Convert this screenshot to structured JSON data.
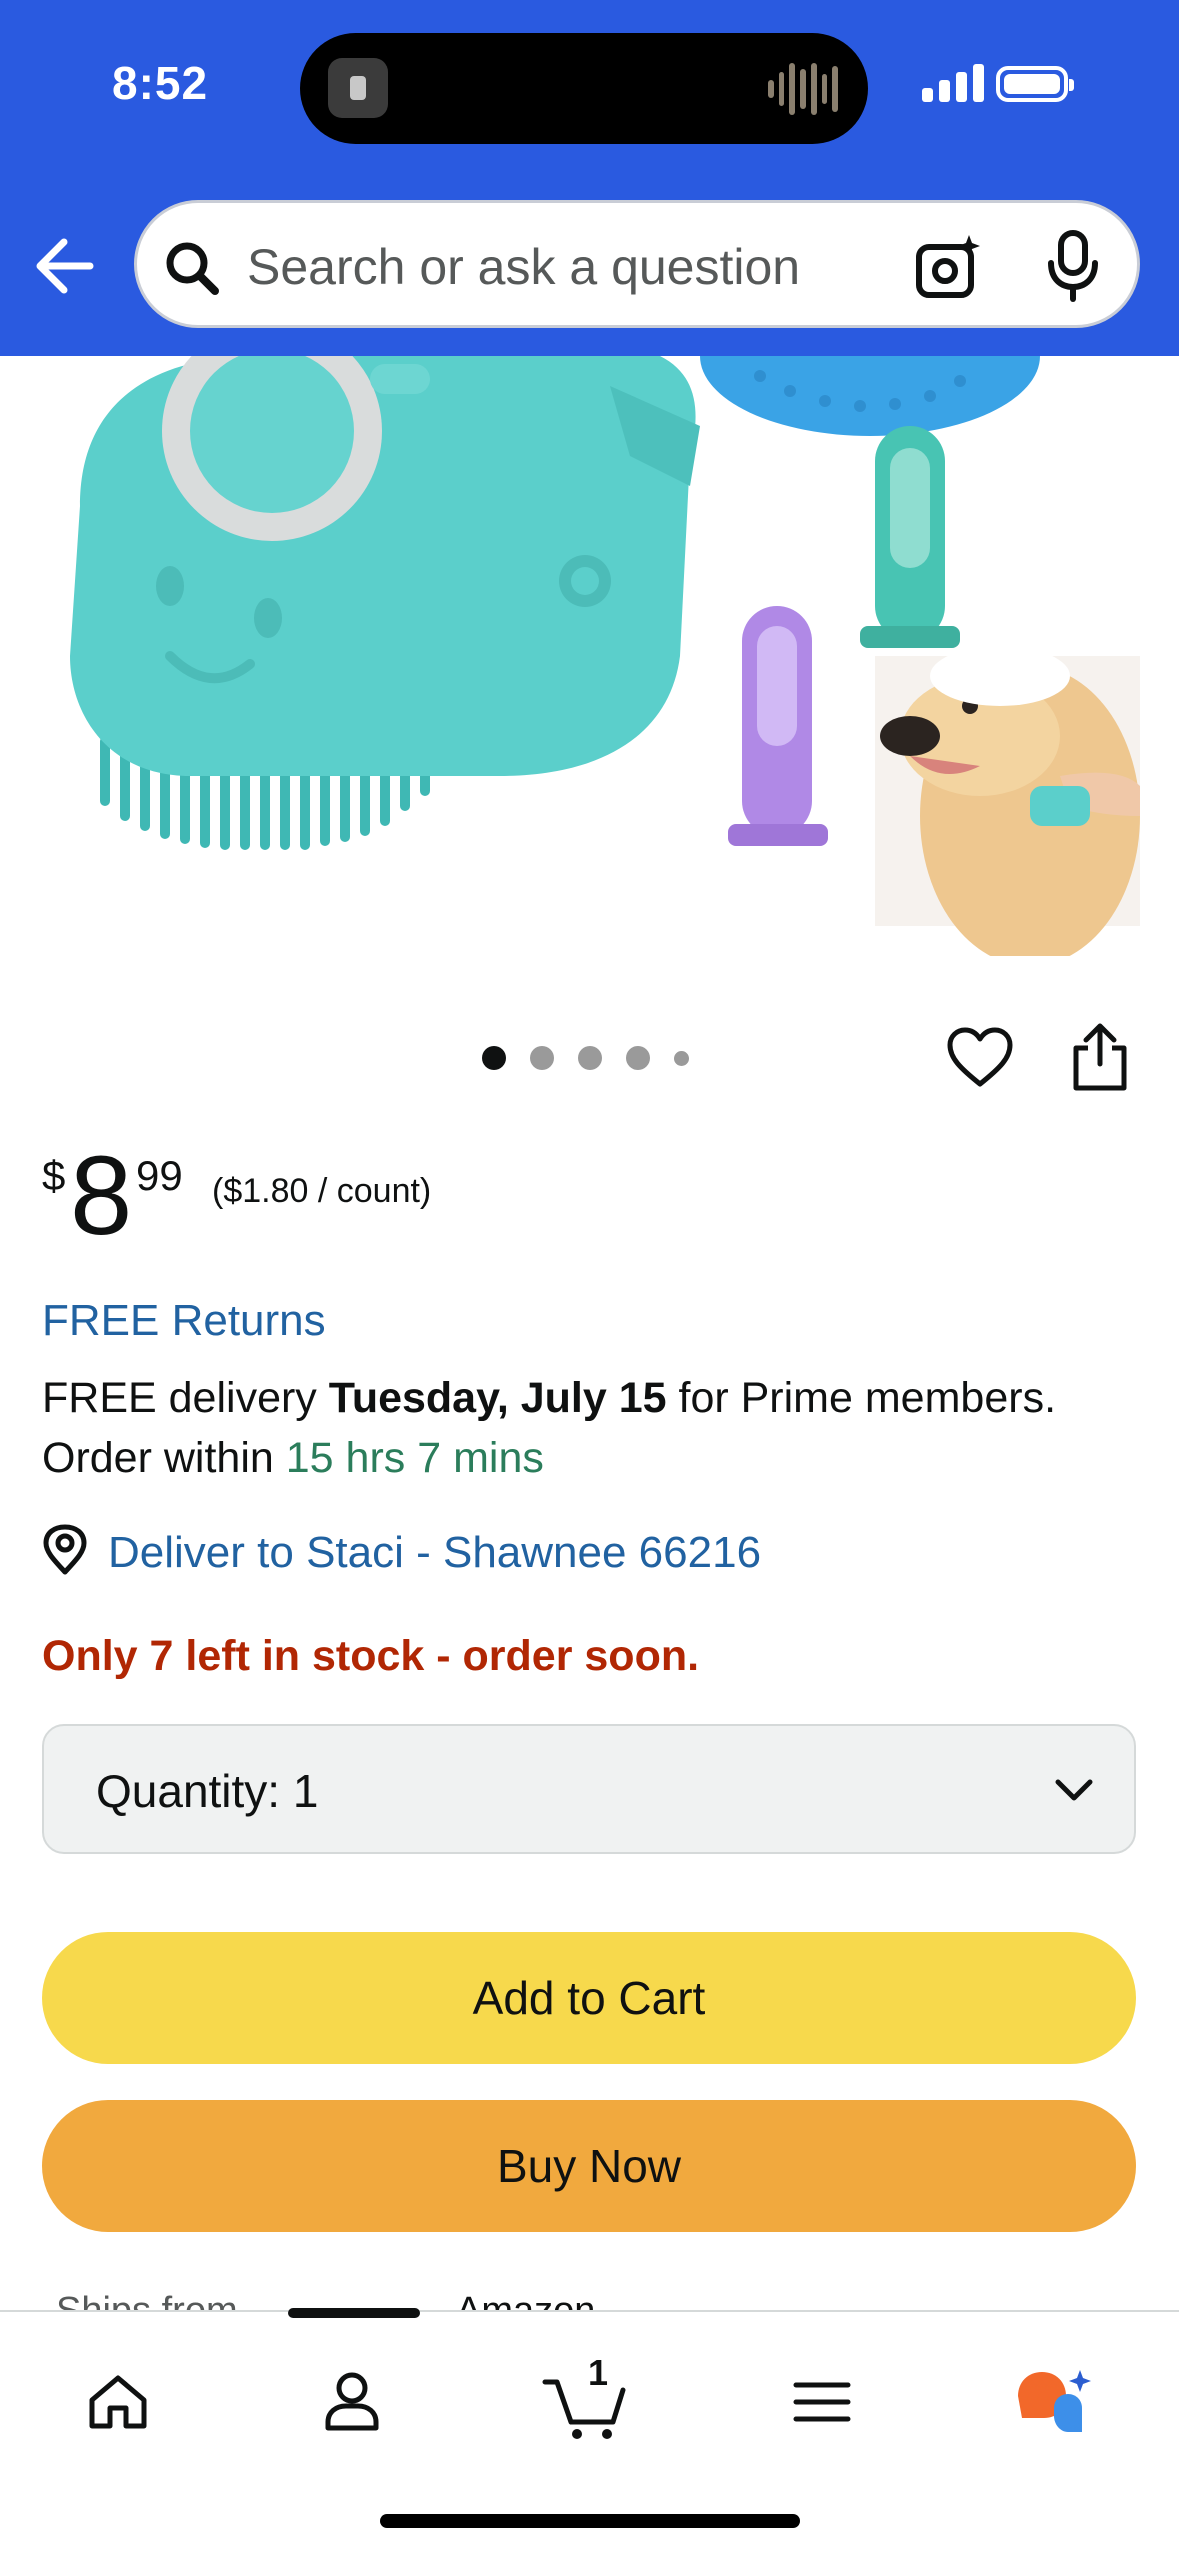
{
  "status_bar": {
    "time": "8:52"
  },
  "header": {
    "search": {
      "placeholder": "Search or ask a question",
      "value": ""
    },
    "icons": [
      "back-arrow-icon",
      "search-icon",
      "camera-scan-icon",
      "microphone-icon"
    ],
    "accent_color": "#2a5ae0"
  },
  "product": {
    "image_alt": "Pet bath massage brush with shampoo dispenser, silicone bath mat, finger toothbrushes and golden retriever",
    "carousel": {
      "total": 5,
      "active_index": 0
    },
    "price": {
      "currency": "$",
      "whole": "8",
      "fraction": "99",
      "unit_price": "($1.80 / count)"
    },
    "free_returns": "FREE Returns",
    "delivery": {
      "prefix": "FREE delivery",
      "date": "Tuesday, July 15",
      "suffix": "for Prime members.",
      "order_within_label": "Order within",
      "countdown": "15 hrs 7 mins"
    },
    "deliver_to": "Deliver to Staci - Shawnee 66216",
    "stock_message": "Only 7 left in stock - order soon.",
    "quantity": {
      "label": "Quantity:",
      "value": "1"
    },
    "add_to_cart": "Add to Cart",
    "buy_now": "Buy Now",
    "ships_from_label": "Ships from",
    "ships_from_value": "Amazon"
  },
  "tabbar": {
    "items": [
      {
        "name": "Home",
        "icon": "home-icon"
      },
      {
        "name": "Account",
        "icon": "person-icon"
      },
      {
        "name": "Cart",
        "icon": "cart-icon",
        "badge": "1"
      },
      {
        "name": "Menu",
        "icon": "menu-icon"
      },
      {
        "name": "Rufus",
        "icon": "rufus-chat-icon"
      }
    ],
    "active_index": 1
  },
  "colors": {
    "link": "#2162a1",
    "stock_red": "#b12704",
    "countdown_green": "#2b7d5b",
    "add_to_cart_yellow": "#f7d94c",
    "buy_now_orange": "#f1a93e"
  }
}
